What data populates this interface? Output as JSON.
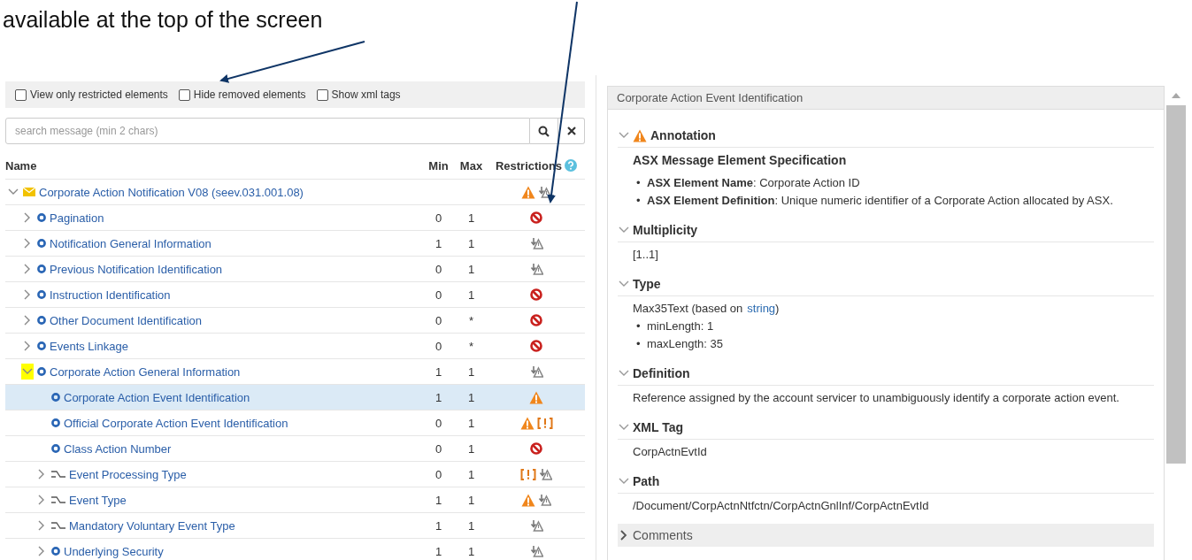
{
  "caption": {
    "text": "available at the top of the screen"
  },
  "toolbar": {
    "options": [
      {
        "label": "View only restricted elements",
        "checked": false
      },
      {
        "label": "Hide removed elements",
        "checked": false
      },
      {
        "label": "Show xml tags",
        "checked": false
      }
    ]
  },
  "search": {
    "placeholder": "search message (min 2 chars)"
  },
  "tree": {
    "columns": {
      "name": "Name",
      "min": "Min",
      "max": "Max",
      "restrictions": "Restrictions"
    },
    "rows": [
      {
        "name": "Corporate Action Notification V08 (seev.031.001.08)",
        "kind": "message",
        "expanded": true,
        "highlighted": false,
        "selected": false,
        "min": "",
        "max": "",
        "restrictions": [
          {
            "kind": "warning"
          },
          {
            "kind": "override"
          }
        ],
        "children": [
          {
            "name": "Pagination",
            "kind": "component",
            "expanded": false,
            "highlighted": false,
            "selected": false,
            "min": "0",
            "max": "1",
            "restrictions": [
              {
                "kind": "removed"
              }
            ]
          },
          {
            "name": "Notification General Information",
            "kind": "component",
            "expanded": false,
            "highlighted": false,
            "selected": false,
            "min": "1",
            "max": "1",
            "restrictions": [
              {
                "kind": "override"
              }
            ]
          },
          {
            "name": "Previous Notification Identification",
            "kind": "component",
            "expanded": false,
            "highlighted": false,
            "selected": false,
            "min": "0",
            "max": "1",
            "restrictions": [
              {
                "kind": "override"
              }
            ]
          },
          {
            "name": "Instruction Identification",
            "kind": "component",
            "expanded": false,
            "highlighted": false,
            "selected": false,
            "min": "0",
            "max": "1",
            "restrictions": [
              {
                "kind": "removed"
              }
            ]
          },
          {
            "name": "Other Document Identification",
            "kind": "component",
            "expanded": false,
            "highlighted": false,
            "selected": false,
            "min": "0",
            "max": "*",
            "restrictions": [
              {
                "kind": "removed"
              }
            ]
          },
          {
            "name": "Events Linkage",
            "kind": "component",
            "expanded": false,
            "highlighted": false,
            "selected": false,
            "min": "0",
            "max": "*",
            "restrictions": [
              {
                "kind": "removed"
              }
            ]
          },
          {
            "name": "Corporate Action General Information",
            "kind": "component",
            "expanded": true,
            "highlighted": true,
            "selected": false,
            "min": "1",
            "max": "1",
            "restrictions": [
              {
                "kind": "override"
              }
            ],
            "children": [
              {
                "name": "Corporate Action Event Identification",
                "kind": "component",
                "highlighted": false,
                "selected": true,
                "min": "1",
                "max": "1",
                "restrictions": [
                  {
                    "kind": "warning"
                  }
                ]
              },
              {
                "name": "Official Corporate Action Event Identification",
                "kind": "component",
                "highlighted": false,
                "selected": false,
                "min": "0",
                "max": "1",
                "restrictions": [
                  {
                    "kind": "warning"
                  },
                  {
                    "kind": "flag"
                  }
                ]
              },
              {
                "name": "Class Action Number",
                "kind": "component",
                "highlighted": false,
                "selected": false,
                "min": "0",
                "max": "1",
                "restrictions": [
                  {
                    "kind": "removed"
                  }
                ]
              },
              {
                "name": "Event Processing Type",
                "kind": "choice",
                "expanded": false,
                "highlighted": false,
                "selected": false,
                "min": "0",
                "max": "1",
                "restrictions": [
                  {
                    "kind": "flag"
                  },
                  {
                    "kind": "override"
                  }
                ]
              },
              {
                "name": "Event Type",
                "kind": "choice",
                "expanded": false,
                "highlighted": false,
                "selected": false,
                "min": "1",
                "max": "1",
                "restrictions": [
                  {
                    "kind": "warning"
                  },
                  {
                    "kind": "override"
                  }
                ]
              },
              {
                "name": "Mandatory Voluntary Event Type",
                "kind": "choice",
                "expanded": false,
                "highlighted": false,
                "selected": false,
                "min": "1",
                "max": "1",
                "restrictions": [
                  {
                    "kind": "override"
                  }
                ]
              },
              {
                "name": "Underlying Security",
                "kind": "component",
                "expanded": false,
                "highlighted": false,
                "selected": false,
                "min": "1",
                "max": "1",
                "restrictions": [
                  {
                    "kind": "override"
                  }
                ]
              }
            ]
          }
        ]
      }
    ]
  },
  "details": {
    "title": "Corporate Action Event Identification",
    "sections": [
      {
        "title": "Annotation",
        "warning": true,
        "expanded": true,
        "blocks": [
          {
            "kind": "heading",
            "text": "ASX Message Element Specification"
          },
          {
            "kind": "bullets",
            "marker": "•",
            "items": [
              "**ASX Element Name**: Corporate Action ID",
              "**ASX Element Definition**: Unique numeric identifier of a Corporate Action allocated by ASX."
            ]
          }
        ]
      },
      {
        "title": "Multiplicity",
        "warning": false,
        "expanded": true,
        "blocks": [
          {
            "kind": "text",
            "text": "[1..1]"
          }
        ]
      },
      {
        "title": "Type",
        "warning": false,
        "expanded": true,
        "blocks": [
          {
            "kind": "typeline",
            "text": "Max35Text (based on",
            "link": "string",
            "after": ")"
          },
          {
            "kind": "bullets",
            "marker": "•",
            "items": [
              "minLength: 1",
              "maxLength: 35"
            ]
          }
        ]
      },
      {
        "title": "Definition",
        "warning": false,
        "expanded": true,
        "blocks": [
          {
            "kind": "text",
            "text": "Reference assigned by the account servicer to unambiguously identify a corporate action event."
          }
        ]
      },
      {
        "title": "XML Tag",
        "warning": false,
        "expanded": true,
        "blocks": [
          {
            "kind": "text",
            "text": "CorpActnEvtId"
          }
        ]
      },
      {
        "title": "Path",
        "warning": false,
        "expanded": true,
        "blocks": [
          {
            "kind": "text",
            "text": "/Document/CorpActnNtfctn/CorpActnGnlInf/CorpActnEvtId"
          }
        ]
      },
      {
        "title": "Comments",
        "warning": false,
        "expanded": false
      }
    ]
  }
}
